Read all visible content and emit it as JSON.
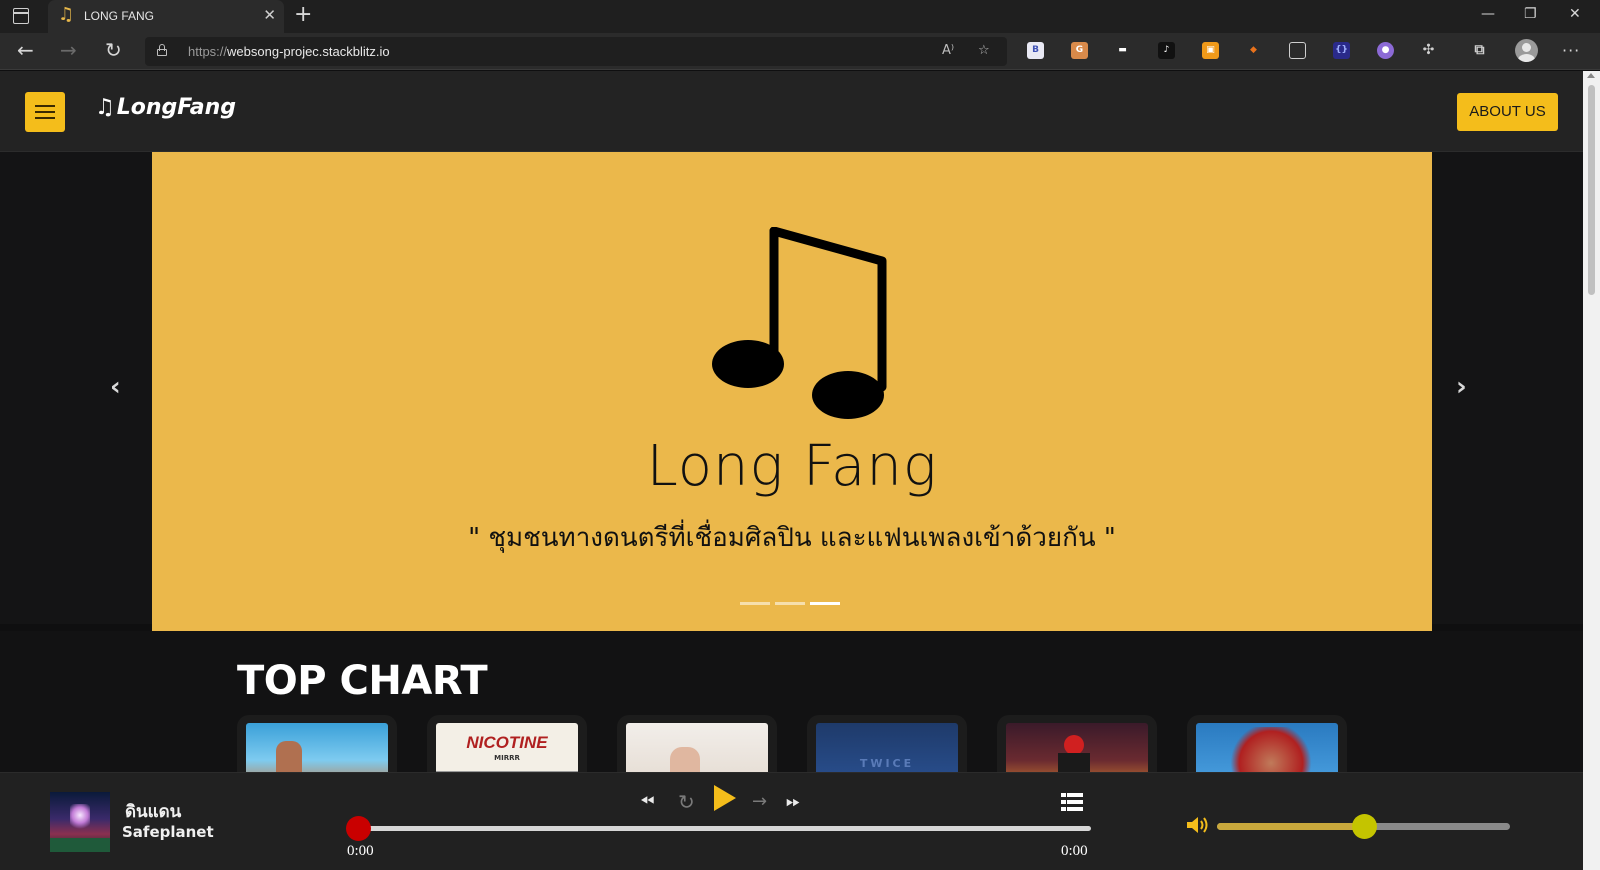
{
  "browser": {
    "tab": {
      "title": "LONG FANG",
      "favicon": "music-note-icon",
      "close": "✕"
    },
    "new_tab": "+",
    "window_controls": {
      "minimize": "—",
      "restore": "❐",
      "close": "✕"
    },
    "address": {
      "scheme": "https://",
      "host": "websong-projec.stackblitz.io"
    }
  },
  "site": {
    "brand": "LongFang",
    "brand_icon": "♫",
    "about_button": "ABOUT US",
    "accent": "#f4bd1b"
  },
  "carousel": {
    "title": "Long Fang",
    "subtitle": "\" ชุมชนทางดนตรีที่เชื่อมศิลปิน และแฟนเพลงเข้าด้วยกัน \"",
    "slide_color": "#ebb84b",
    "indicator_count": 3,
    "active_index": 2,
    "prev": "‹",
    "next": "›"
  },
  "top_chart": {
    "heading": "TOP CHART",
    "cards": [
      {
        "name": "card-1"
      },
      {
        "name": "card-2",
        "title": "NICOTINE",
        "subtitle": "MIRRR"
      },
      {
        "name": "card-3"
      },
      {
        "name": "card-4",
        "title": "TWICE"
      },
      {
        "name": "card-5"
      },
      {
        "name": "card-6"
      }
    ]
  },
  "player": {
    "song_title": "ดินแดน",
    "artist": "Safeplanet",
    "current_time": "0:00",
    "duration": "0:00",
    "progress": 0,
    "volume": 0.5,
    "progress_color": "#c90000",
    "volume_color": "#c9a83c"
  }
}
